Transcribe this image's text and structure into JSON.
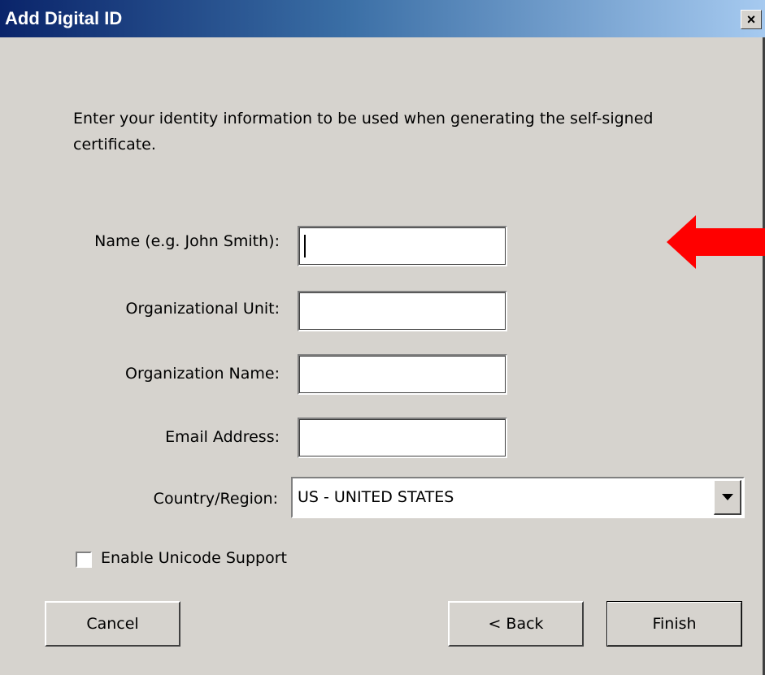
{
  "window": {
    "title": "Add Digital ID",
    "close_glyph": "×"
  },
  "intro": "Enter your identity information to be used when generating the self-signed certificate.",
  "fields": {
    "name": {
      "label": "Name (e.g. John Smith):",
      "value": ""
    },
    "org_unit": {
      "label": "Organizational Unit:",
      "value": ""
    },
    "org_name": {
      "label": "Organization Name:",
      "value": ""
    },
    "email": {
      "label": "Email Address:",
      "value": ""
    }
  },
  "country": {
    "label": "Country/Region:",
    "selected": "US - UNITED STATES"
  },
  "unicode": {
    "label": "Enable Unicode Support",
    "checked": false
  },
  "buttons": {
    "cancel": "Cancel",
    "back": "< Back",
    "finish": "Finish"
  },
  "annotation": {
    "icon": "red-arrow-icon",
    "color": "#ff0000"
  }
}
